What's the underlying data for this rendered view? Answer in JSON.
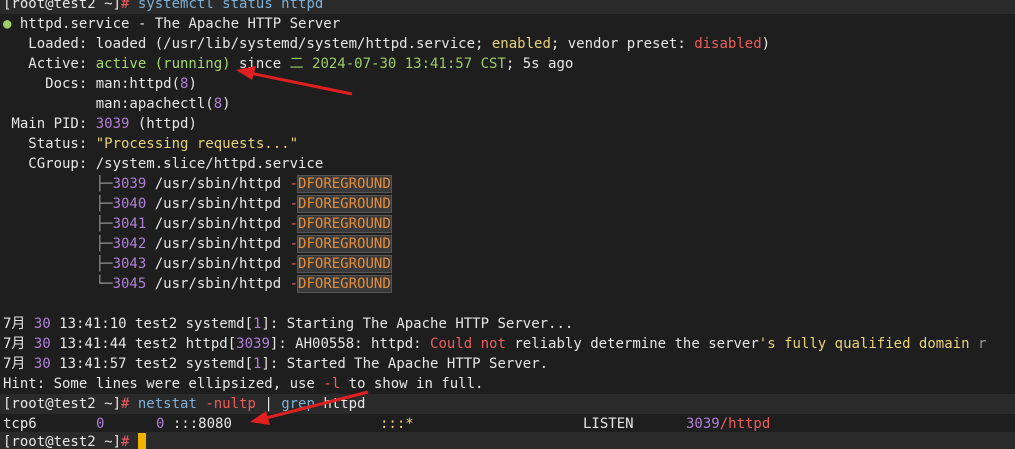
{
  "lines": {
    "l0": {
      "prompt": "[root@test2 ~]",
      "hash": "#",
      "cmd": "systemctl status httpd"
    },
    "l1": {
      "dot": "●",
      "text": " httpd.service - The Apache HTTP Server"
    },
    "l2": {
      "label": "   Loaded: ",
      "a": "loaded (/usr/lib/systemd/system/httpd.service; ",
      "b": "enabled",
      "c": "; vendor preset: ",
      "d": "disabled",
      ".": ")"
    },
    "l3": {
      "label": "   Active: ",
      "a": "active (running)",
      "b": " since ",
      "c": "二 2024-07-30 13:41:57 CST",
      "d": "; 5s ago"
    },
    "l4": {
      "label": "     Docs: ",
      "a": "man:httpd(",
      "b": "8",
      "c": ")"
    },
    "l5": {
      "pad": "           ",
      "a": "man:apachectl(",
      "b": "8",
      "c": ")"
    },
    "l6": {
      "label": " Main PID: ",
      "a": "3039",
      "b": " (httpd)"
    },
    "l7": {
      "label": "   Status: ",
      "a": "\"Processing requests...\""
    },
    "l8": {
      "label": "   CGroup: ",
      "a": "/system.slice/httpd.service"
    },
    "tree": [
      {
        "branch": "           ├─",
        "pid": "3039",
        "cmd": " /usr/sbin/httpd ",
        "dash": "-",
        "flag": "DFOREGROUND"
      },
      {
        "branch": "           ├─",
        "pid": "3040",
        "cmd": " /usr/sbin/httpd ",
        "dash": "-",
        "flag": "DFOREGROUND"
      },
      {
        "branch": "           ├─",
        "pid": "3041",
        "cmd": " /usr/sbin/httpd ",
        "dash": "-",
        "flag": "DFOREGROUND"
      },
      {
        "branch": "           ├─",
        "pid": "3042",
        "cmd": " /usr/sbin/httpd ",
        "dash": "-",
        "flag": "DFOREGROUND"
      },
      {
        "branch": "           ├─",
        "pid": "3043",
        "cmd": " /usr/sbin/httpd ",
        "dash": "-",
        "flag": "DFOREGROUND"
      },
      {
        "branch": "           └─",
        "pid": "3045",
        "cmd": " /usr/sbin/httpd ",
        "dash": "-",
        "flag": "DFOREGROUND"
      }
    ],
    "log1": {
      "m": "7月",
      "d": " 30 ",
      "t": "13:41:10",
      "h": " test2 systemd[",
      "n": "1",
      "e": "]: Starting The Apache HTTP Server..."
    },
    "log2": {
      "m": "7月",
      "d": " 30 ",
      "t": "13:41:44",
      "h": " test2 httpd[",
      "n": "3039",
      "e": "]: AH00558: httpd: ",
      "r": "Could not",
      "rest": " reliably determine the server",
      "q": "'s fully qualified domain ",
      "tail": "r"
    },
    "log3": {
      "m": "7月",
      "d": " 30 ",
      "t": "13:41:57",
      "h": " test2 systemd[",
      "n": "1",
      "e": "]: Started The Apache HTTP Server."
    },
    "hint": {
      "a": "Hint: Some lines were ellipsized, use ",
      "b": "-l",
      "c": " to show in full."
    },
    "l15": {
      "prompt": "[root@test2 ~]",
      "hash": "#",
      "cmd": " netstat ",
      "opt": "-nultp",
      "pipe": " | ",
      "grep": "grep",
      "arg": " httpd"
    },
    "l16": {
      "proto": "tcp6",
      "recv": "0",
      "send": "0",
      "local": ":::8080",
      "foreign": ":::*",
      "state": "LISTEN",
      "pid": "3039",
      "prog": "/httpd"
    },
    "l17": {
      "prompt": "[root@test2 ~]",
      "hash": "#"
    }
  },
  "colors": {
    "background": "#1e1e1e",
    "prompt": "#e6e6e6",
    "green": "#9ccc65",
    "yellow": "#e8d27a",
    "purple": "#b07fd6",
    "red": "#ee5d5d",
    "orange_flag": "#e58d3a",
    "cursor": "#f0b400",
    "arrow": "#e02020"
  }
}
